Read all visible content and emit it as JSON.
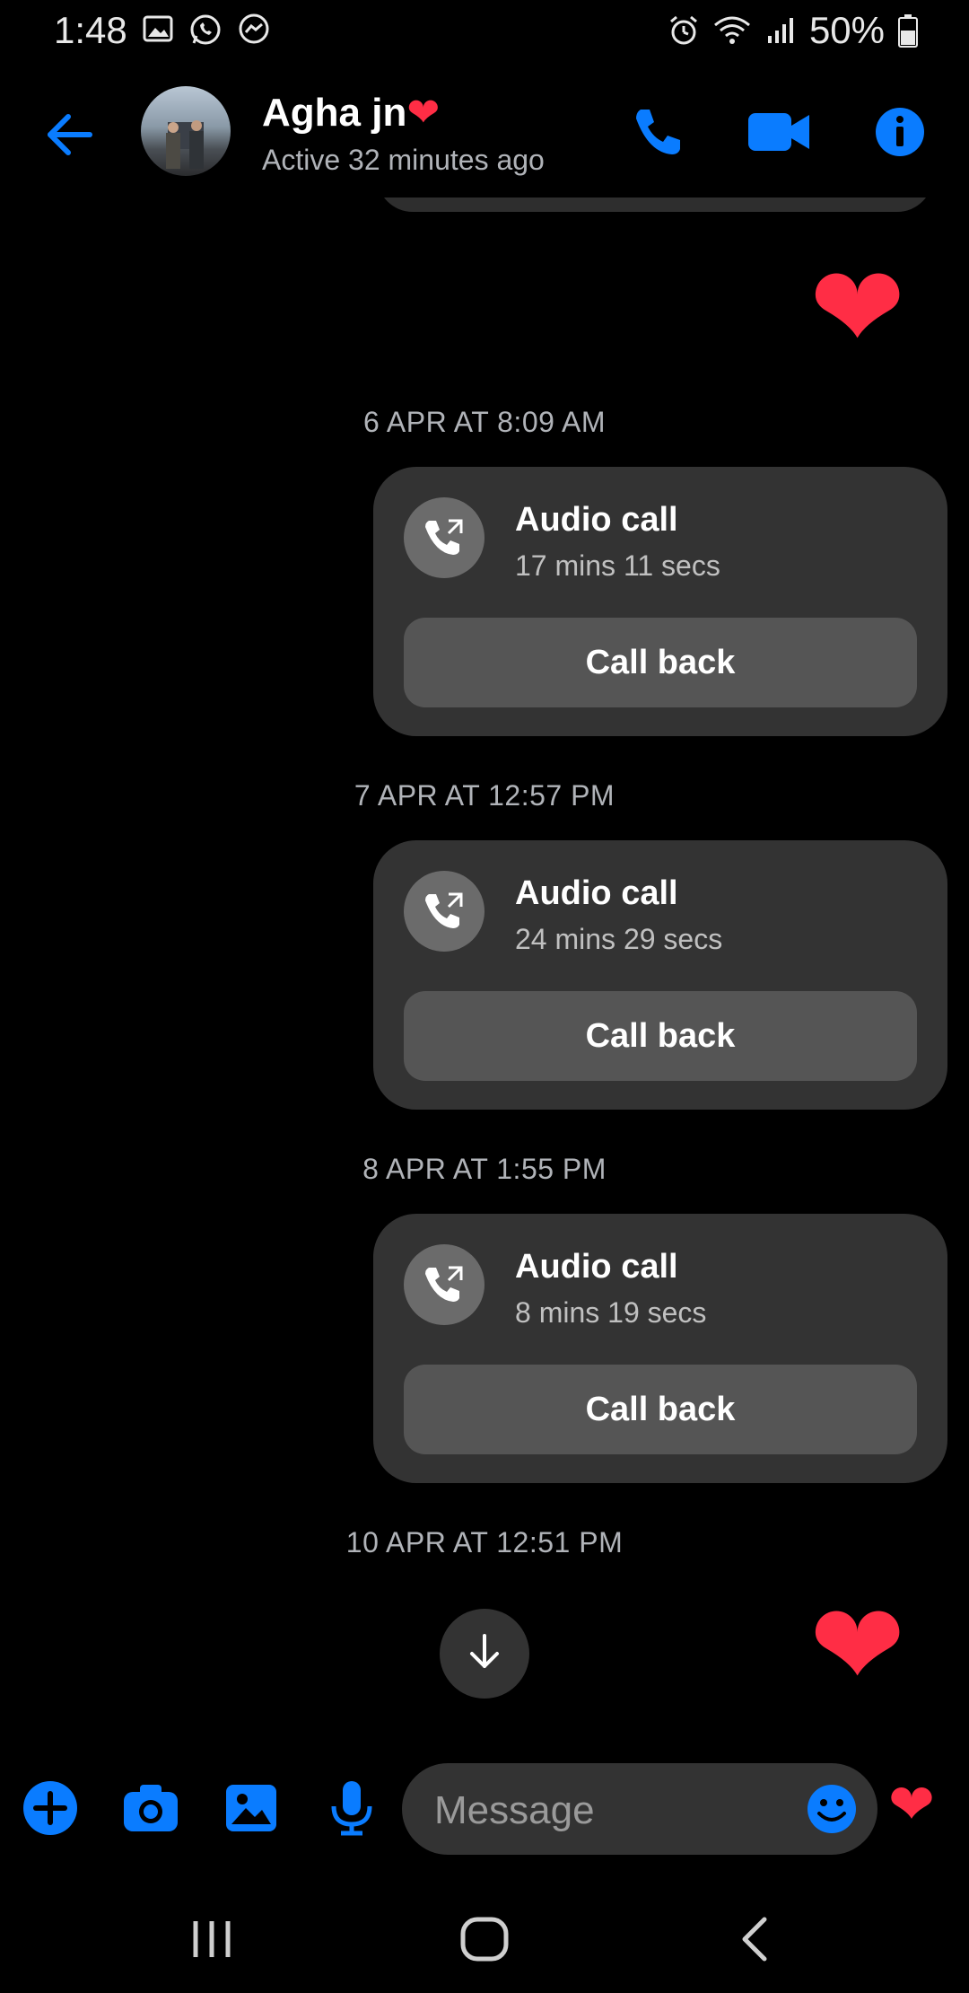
{
  "status_bar": {
    "time": "1:48",
    "battery": "50%",
    "icons": [
      "gallery-icon",
      "whatsapp-icon",
      "messenger-icon",
      "alarm-icon",
      "wifi-icon",
      "signal-icon",
      "battery-icon"
    ]
  },
  "header": {
    "contact_name": "Agha jn",
    "name_emoji": "❤",
    "status": "Active 32 minutes ago"
  },
  "messages": {
    "timestamps": [
      "6 APR AT 8:09 AM",
      "7 APR AT 12:57 PM",
      "8 APR AT 1:55 PM",
      "10 APR AT 12:51 PM"
    ],
    "calls": [
      {
        "title": "Audio call",
        "duration": "17 mins 11 secs",
        "button": "Call back"
      },
      {
        "title": "Audio call",
        "duration": "24 mins 29 secs",
        "button": "Call back"
      },
      {
        "title": "Audio call",
        "duration": "8 mins 19 secs",
        "button": "Call back"
      }
    ],
    "heart": "❤"
  },
  "composer": {
    "placeholder": "Message",
    "heart": "❤"
  },
  "colors": {
    "accent": "#0a7cff",
    "background": "#000000",
    "bubble": "#333333",
    "button": "#555555",
    "heart": "#ff2d45"
  }
}
